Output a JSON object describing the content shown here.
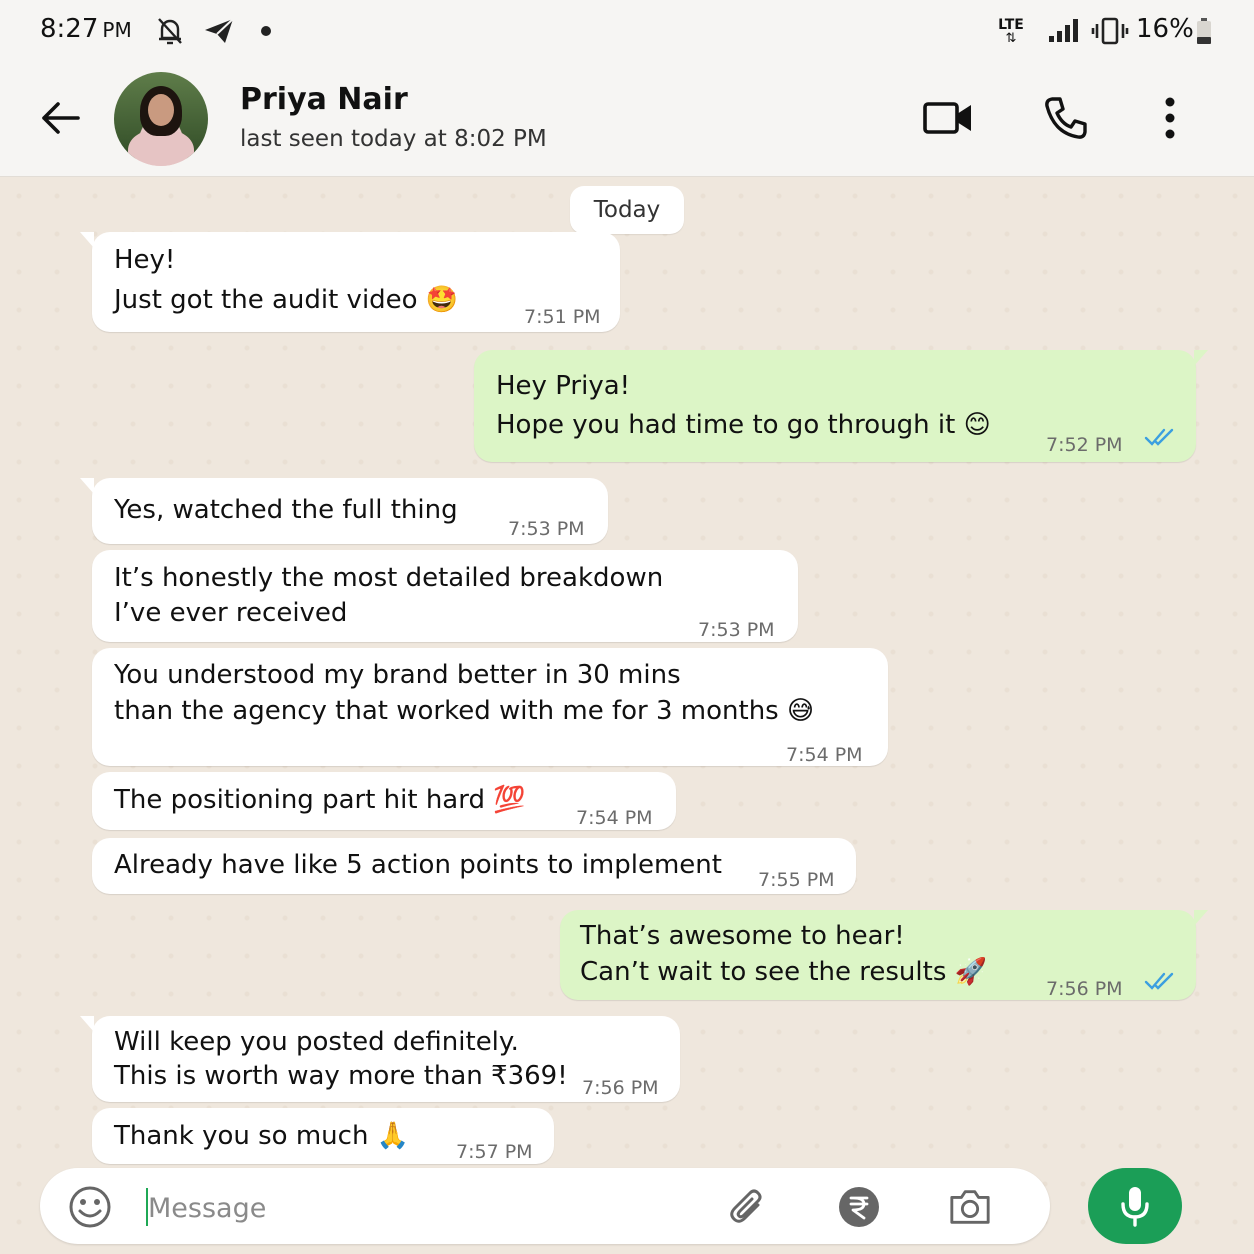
{
  "status_bar": {
    "time": "8:27",
    "ampm": "PM",
    "network": "LTE",
    "battery": "16%"
  },
  "header": {
    "contact_name": "Priya Nair",
    "last_seen": "last seen today at 8:02 PM"
  },
  "chat": {
    "date_label": "Today",
    "messages": [
      {
        "dir": "in",
        "lines": [
          "Hey!",
          "Just got the audit video 🤩"
        ],
        "time": "7:51 PM"
      },
      {
        "dir": "out",
        "lines": [
          "Hey Priya!",
          "Hope you had time to go through it 😊"
        ],
        "time": "7:52 PM",
        "read": true
      },
      {
        "dir": "in",
        "lines": [
          "Yes, watched the full thing"
        ],
        "time": "7:53 PM"
      },
      {
        "dir": "in",
        "lines": [
          "It’s honestly the most detailed breakdown",
          "I’ve ever received"
        ],
        "time": "7:53 PM"
      },
      {
        "dir": "in",
        "lines": [
          "You understood my brand better in 30 mins",
          "than the agency that worked with me for 3 months 😅"
        ],
        "time": "7:54 PM"
      },
      {
        "dir": "in",
        "lines": [
          "The positioning part hit hard 💯"
        ],
        "time": "7:54 PM"
      },
      {
        "dir": "in",
        "lines": [
          "Already have like 5 action points to implement"
        ],
        "time": "7:55 PM"
      },
      {
        "dir": "out",
        "lines": [
          "That’s awesome to hear!",
          "Can’t wait to see the results 🚀"
        ],
        "time": "7:56 PM",
        "read": true
      },
      {
        "dir": "in",
        "lines": [
          "Will keep you posted definitely.",
          "This is worth way more than ₹369!"
        ],
        "time": "7:56 PM"
      },
      {
        "dir": "in",
        "lines": [
          "Thank you so much 🙏"
        ],
        "time": "7:57 PM"
      }
    ]
  },
  "composer": {
    "placeholder": "Message",
    "value": ""
  },
  "colors": {
    "outgoing_bubble": "#dcf5c6",
    "incoming_bubble": "#ffffff",
    "chat_bg": "#efe7dd",
    "mic_button": "#1b9e57",
    "read_ticks": "#3b9fe0"
  },
  "icons": [
    "back-arrow-icon",
    "video-call-icon",
    "phone-icon",
    "more-options-icon",
    "emoji-icon",
    "attach-icon",
    "rupee-payment-icon",
    "camera-icon",
    "mic-icon"
  ]
}
